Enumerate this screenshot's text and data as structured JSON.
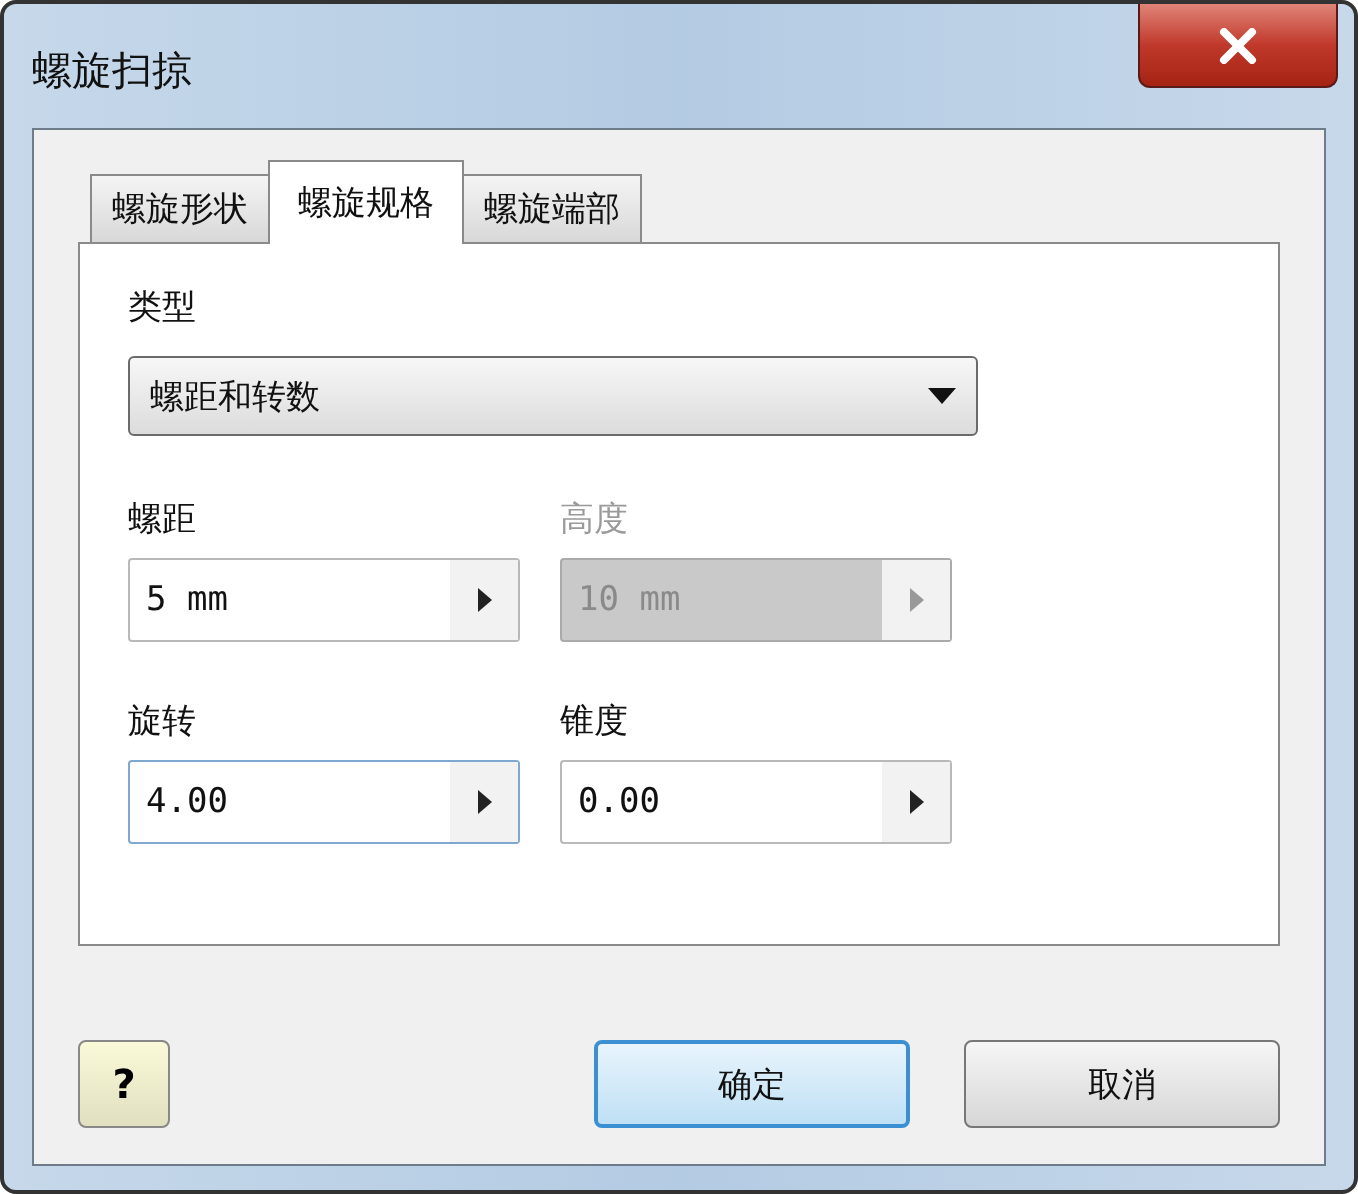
{
  "window": {
    "title": "螺旋扫掠"
  },
  "tabs": [
    {
      "label": "螺旋形状",
      "selected": false
    },
    {
      "label": "螺旋规格",
      "selected": true
    },
    {
      "label": "螺旋端部",
      "selected": false
    }
  ],
  "type": {
    "label": "类型",
    "value": "螺距和转数"
  },
  "fields": [
    {
      "label": "螺距",
      "value": "5 mm",
      "disabled": false,
      "focused": false
    },
    {
      "label": "高度",
      "value": "10 mm",
      "disabled": true,
      "focused": false
    },
    {
      "label": "旋转",
      "value": "4.00",
      "disabled": false,
      "focused": true
    },
    {
      "label": "锥度",
      "value": "0.00",
      "disabled": false,
      "focused": false
    }
  ],
  "help_button": {
    "label": "?"
  },
  "buttons": [
    {
      "label": "确定",
      "default": true
    },
    {
      "label": "取消",
      "default": false
    }
  ]
}
